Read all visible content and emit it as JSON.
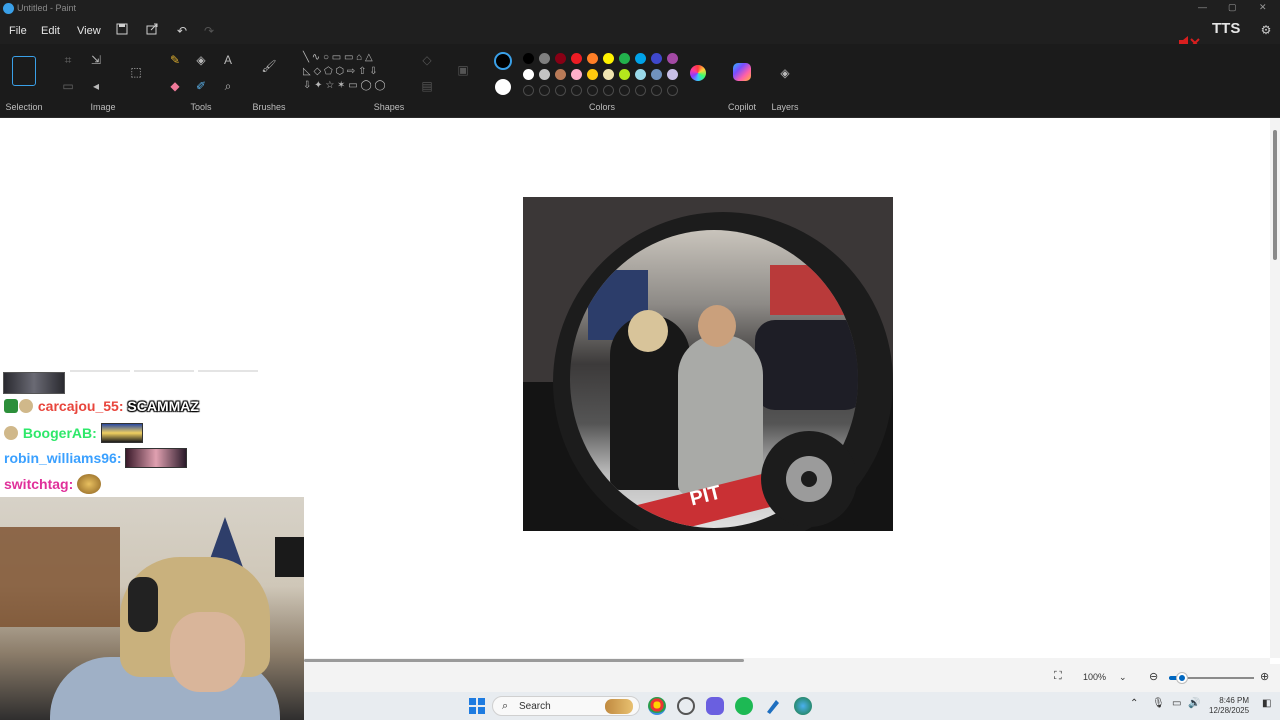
{
  "window": {
    "title": "Untitled - Paint"
  },
  "menu": {
    "file": "File",
    "edit": "Edit",
    "view": "View"
  },
  "overlay": {
    "tts": "TTS"
  },
  "ribbon": {
    "groups": {
      "selection": "Selection",
      "image": "Image",
      "tools": "Tools",
      "brushes": "Brushes",
      "shapes": "Shapes",
      "colors": "Colors",
      "copilot": "Copilot",
      "layers": "Layers"
    },
    "palette_row1": [
      "#000000",
      "#7f7f7f",
      "#880015",
      "#ed1c24",
      "#ff7f27",
      "#fff200",
      "#22b14c",
      "#00a2e8",
      "#3f48cc",
      "#a349a4"
    ],
    "palette_row2": [
      "#ffffff",
      "#c3c3c3",
      "#b97a57",
      "#ffaec9",
      "#ffc90e",
      "#efe4b0",
      "#b5e61d",
      "#99d9ea",
      "#7092be",
      "#c8bfe7"
    ],
    "primary_color": "#000000",
    "secondary_color": "#ffffff"
  },
  "canvas_image": {
    "floor_text": "PIT"
  },
  "chat": [
    {
      "user": "carcajou_55:",
      "user_color": "#e8453c",
      "message": "SCAMMAZ",
      "badges": [
        "#2c8f3a",
        "#d0b88a"
      ]
    },
    {
      "user": "BoogerAB:",
      "user_color": "#2ee86a",
      "message": "",
      "badges": [
        "#d0b88a"
      ],
      "emote": true
    },
    {
      "user": "robin_williams96:",
      "user_color": "#3aa0ff",
      "message": "",
      "badges": [],
      "emote": true
    },
    {
      "user": "switchtag:",
      "user_color": "#e0309a",
      "message": "",
      "badges": [],
      "emote": true
    }
  ],
  "status": {
    "zoom": "100%",
    "zoom_level": 0.15
  },
  "taskbar": {
    "search_label": "Search",
    "time": "8:46 PM",
    "date": "12/28/2025"
  }
}
